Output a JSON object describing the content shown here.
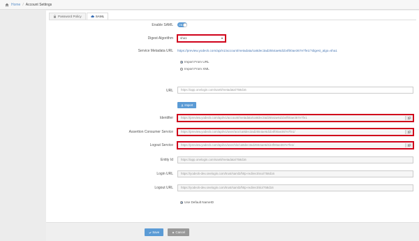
{
  "breadcrumb": {
    "home": "Home",
    "current": "Account Settings"
  },
  "tabs": [
    {
      "label": "Password Policy",
      "icon": "lock-icon"
    },
    {
      "label": "SAML",
      "icon": "cloud-icon"
    }
  ],
  "form": {
    "enable_saml": {
      "label": "Enable SAML",
      "toggle_text": "ON",
      "value": true
    },
    "digest": {
      "label": "Digest Algorithm",
      "value": "sha1"
    },
    "metadata_url": {
      "label": "Service Metadata URL",
      "value": "https://preview.yodeck.com/api/v1/account/metadata/ca8dec3ad2554ae6d1b4f00ae367e7fe1/?digest_algo=sha1"
    },
    "import_mode": {
      "options": [
        "Import From URL",
        "Import From XML"
      ],
      "selected": "Import From URL"
    },
    "url": {
      "label": "URL",
      "value": "https://app.onelogin.com/saml/metadata/758d16"
    },
    "import_button": "Import",
    "identifier": {
      "label": "Identifier",
      "value": "https://preview.yodeck.com/api/v1/account/metadata/ca8dec3ad2554ae6d1b4f00ae367e7fe1"
    },
    "acs": {
      "label": "Assertion Consumer Service",
      "value": "https://preview.yodeck.com/api/v1/user/acs/ca8dec3ad2554ae6d1b4f00ae367e7fe1/"
    },
    "logout_service": {
      "label": "Logout Service",
      "value": "https://preview.yodeck.com/api/v1/user/slo/ca8dec3ad2554ae6d1b4f00ae367e7fe1/"
    },
    "entity_id": {
      "label": "Entity Id",
      "value": "https://app.onelogin.com/saml/metadata/758d16"
    },
    "login_url": {
      "label": "Login URL",
      "value": "https://yodeck-dev.onelogin.com/trust/saml2/http-redirect/sso/758d16"
    },
    "logout_url": {
      "label": "Logout URL",
      "value": "https://yodeck-dev.onelogin.com/trust/saml2/http-redirect/slo/758d16"
    },
    "default_nameid": {
      "label": "Use Default NameID",
      "checked": true
    }
  },
  "footer": {
    "save": "Save",
    "cancel": "Cancel"
  },
  "colors": {
    "accent": "#5b9bd5",
    "highlight": "#d0021b",
    "link": "#4a78b3"
  }
}
